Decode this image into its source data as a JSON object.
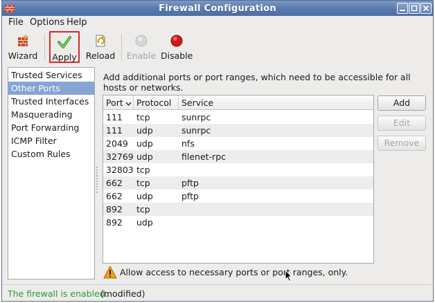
{
  "window": {
    "title": "Firewall Configuration"
  },
  "menu": {
    "items": [
      "File",
      "Options",
      "Help"
    ]
  },
  "toolbar": {
    "items": [
      {
        "label": "Wizard",
        "icon": "wizard-icon",
        "enabled": true
      },
      {
        "label": "Apply",
        "icon": "check-icon",
        "enabled": true,
        "highlighted": true
      },
      {
        "label": "Reload",
        "icon": "reload-icon",
        "enabled": true
      },
      {
        "label": "Enable",
        "icon": "enable-icon",
        "enabled": false
      },
      {
        "label": "Disable",
        "icon": "disable-icon",
        "enabled": true
      }
    ]
  },
  "sidebar": {
    "items": [
      {
        "label": "Trusted Services"
      },
      {
        "label": "Other Ports",
        "selected": true
      },
      {
        "label": "Trusted Interfaces"
      },
      {
        "label": "Masquerading"
      },
      {
        "label": "Port Forwarding"
      },
      {
        "label": "ICMP Filter"
      },
      {
        "label": "Custom Rules"
      }
    ]
  },
  "main": {
    "description": "Add additional ports or port ranges, which need to be accessible for all hosts or networks.",
    "table": {
      "headers": [
        "Port",
        "Protocol",
        "Service"
      ],
      "sorted_column": "Port",
      "rows": [
        [
          "111",
          "tcp",
          "sunrpc"
        ],
        [
          "111",
          "udp",
          "sunrpc"
        ],
        [
          "2049",
          "udp",
          "nfs"
        ],
        [
          "32769",
          "udp",
          "filenet-rpc"
        ],
        [
          "32803",
          "tcp",
          ""
        ],
        [
          "662",
          "tcp",
          "pftp"
        ],
        [
          "662",
          "udp",
          "pftp"
        ],
        [
          "892",
          "tcp",
          ""
        ],
        [
          "892",
          "udp",
          ""
        ]
      ]
    },
    "buttons": {
      "add": "Add",
      "edit": "Edit",
      "remove": "Remove"
    },
    "hint": "Allow access to necessary ports or port ranges, only."
  },
  "status": {
    "state": "The firewall is enabled.",
    "modified": "(modified)"
  },
  "colors": {
    "titlebar": "#5a7bae",
    "selection": "#86a4d5",
    "status_ok": "#2e9a2e",
    "highlight_border": "#d9262a"
  }
}
